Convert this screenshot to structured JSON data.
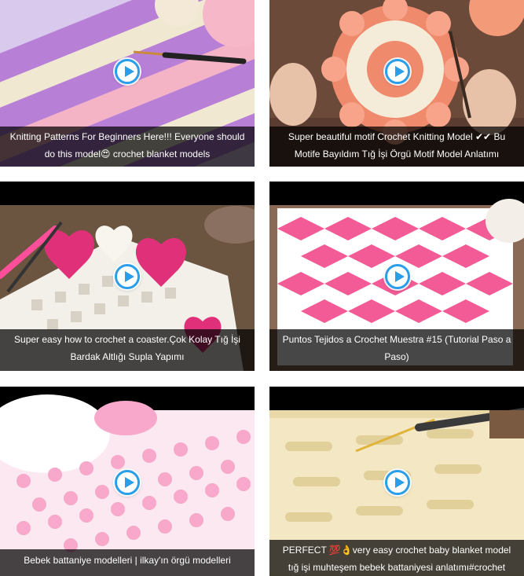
{
  "videos": [
    {
      "title": "Knitting Patterns For Beginners Here!!! Everyone should do this model😍 crochet blanket models",
      "thumbnail": "purple-cream-pink-knit-rows",
      "colors": [
        "#b77fd6",
        "#f1e8d2",
        "#f5b3c6"
      ]
    },
    {
      "title": "Super beautiful motif Crochet Knitting Model ✔✔ Bu Motife Bayıldım Tığ İşi Örgü Motif Model Anlatımı",
      "thumbnail": "round-peach-cream-motif",
      "colors": [
        "#f08a6c",
        "#f4ecd9",
        "#6b4a3a"
      ]
    },
    {
      "title": "Super easy how to crochet a coaster.Çok Kolay Tığ İşi Bardak Altlığı Supla Yapımı",
      "thumbnail": "white-coaster-pink-hearts",
      "colors": [
        "#e0307a",
        "#f3f0ea",
        "#6b5440"
      ]
    },
    {
      "title": "Puntos Tejidos a Crochet Muestra #15 (Tutorial Paso a Paso)",
      "thumbnail": "pink-white-basketweave",
      "colors": [
        "#f25b95",
        "#ffffff",
        "#8a6a55"
      ]
    },
    {
      "title": "Bebek battaniye modelleri | ilkay'ın örgü modelleri",
      "thumbnail": "pink-bobble-stitch-blanket",
      "colors": [
        "#f7a8cb",
        "#fbe8f0",
        "#ffffff"
      ]
    },
    {
      "title": "PERFECT 💯👌very easy crochet baby blanket model tığ işi muhteşem bebek battaniyesi anlatımı#crochet",
      "thumbnail": "cream-puff-stitch-blanket",
      "colors": [
        "#f3e7c4",
        "#e9d9a8",
        "#3a3a3a"
      ]
    }
  ],
  "play_icon_color": "#2a9ee8"
}
